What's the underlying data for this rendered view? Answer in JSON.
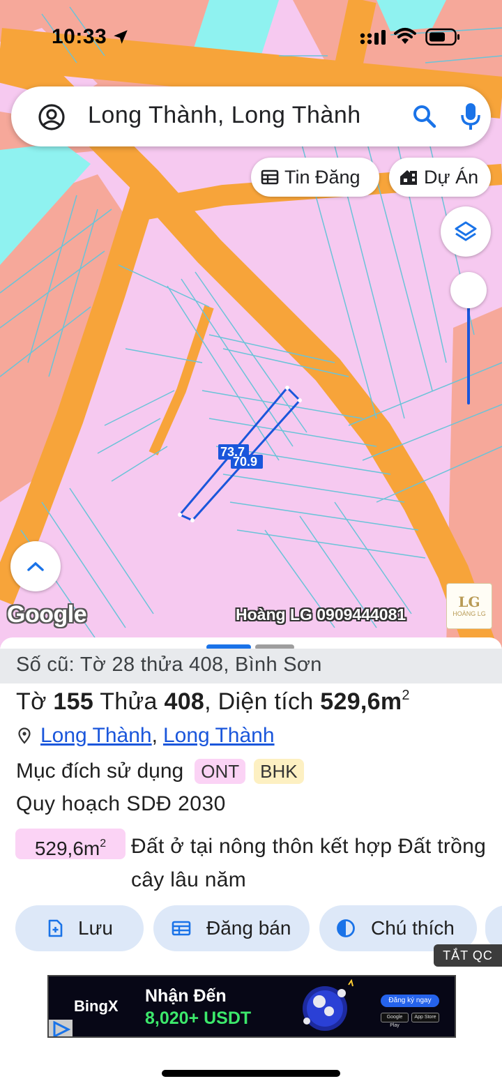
{
  "status_bar": {
    "time": "10:33",
    "icons": [
      "location-arrow-icon",
      "signal-icon",
      "wifi-icon",
      "battery-icon"
    ]
  },
  "search": {
    "query": "Long Thành, Long Thành",
    "icons": [
      "account-icon",
      "search-icon",
      "mic-icon"
    ]
  },
  "chips": {
    "listings": "Tin Đăng",
    "projects": "Dự Án"
  },
  "map": {
    "measure_1": "73.7",
    "measure_2": "70.9",
    "google_logo": "Google",
    "watermark": "Hoàng LG 0909444081",
    "brand_logo_letters": "LG",
    "brand_logo_name": "HOÀNG LG",
    "colors": {
      "residential": "#f6c9f0",
      "road": "#f7a43a",
      "commercial": "#f6a89a",
      "water": "#8ff2f0",
      "parcel_outline": "#6ac3d8",
      "selection": "#1a56db"
    },
    "zoom_slider_level": 0.0
  },
  "sheet": {
    "old_number": "Số cũ: Tờ 28 thửa 408, Bình Sơn",
    "parcel": {
      "sheet_label": "Tờ",
      "sheet_no": "155",
      "lot_label": "Thửa",
      "lot_no": "408",
      "area_label": "Diện tích",
      "area": "529,6m",
      "area_unit_sup": "2"
    },
    "location": {
      "ward": "Long Thành",
      "separator": ",",
      "district": "Long Thành"
    },
    "land_use": {
      "label": "Mục đích sử dụng",
      "codes": [
        "ONT",
        "BHK"
      ]
    },
    "plan": {
      "title": "Quy hoạch SDĐ 2030",
      "area": "529,6m",
      "area_sup": "2",
      "description": "Đất ở tại nông thôn kết hợp Đất trồng cây lâu năm"
    },
    "actions": {
      "save": "Lưu",
      "post_sale": "Đăng bán",
      "legend": "Chú thích"
    },
    "ad_toggle": "TẮT QC"
  },
  "ad": {
    "brand": "BingX",
    "headline": "Nhận Đến",
    "amount": "8,020+ USDT",
    "cta": "Đăng ký ngay",
    "stores": [
      "Google Play",
      "App Store"
    ]
  }
}
